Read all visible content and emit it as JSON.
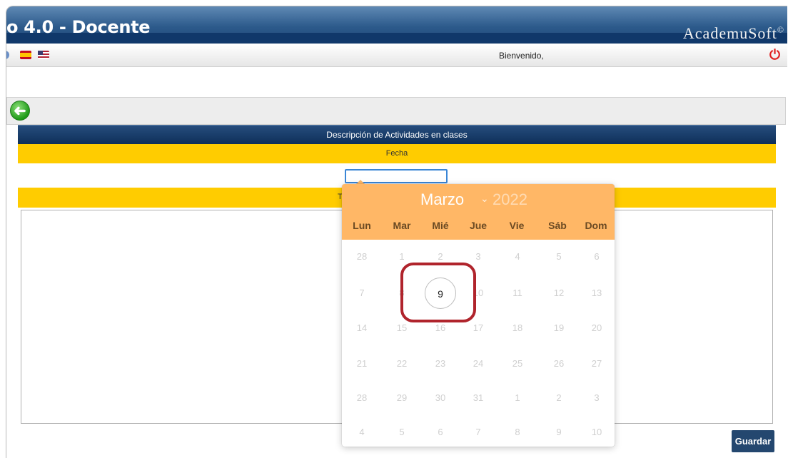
{
  "banner": {
    "title": "o 4.0 - Docente",
    "brand": "AcademuSoft",
    "brand_mark": "©"
  },
  "toolbar": {
    "welcome": "Bienvenido,",
    "icons": [
      "help-icon",
      "spanish-flag-icon",
      "english-flag-icon",
      "power-icon"
    ]
  },
  "navbar": {
    "back_icon": "arrow-left-icon",
    "back_glyph": "➜"
  },
  "form": {
    "header": "Descripción de Actividades en clases",
    "fecha_label": "Fecha",
    "date_value": "",
    "second_label": "T",
    "textarea_value": "",
    "save_label": "Guardar"
  },
  "datepicker": {
    "month": "Marzo",
    "year": "2022",
    "weekdays": [
      "Lun",
      "Mar",
      "Mié",
      "Jue",
      "Vie",
      "Sáb",
      "Dom"
    ],
    "weeks": [
      [
        "28",
        "1",
        "2",
        "3",
        "4",
        "5",
        "6"
      ],
      [
        "7",
        "8",
        "9",
        "10",
        "11",
        "12",
        "13"
      ],
      [
        "14",
        "15",
        "16",
        "17",
        "18",
        "19",
        "20"
      ],
      [
        "21",
        "22",
        "23",
        "24",
        "25",
        "26",
        "27"
      ],
      [
        "28",
        "29",
        "30",
        "31",
        "1",
        "2",
        "3"
      ],
      [
        "4",
        "5",
        "6",
        "7",
        "8",
        "9",
        "10"
      ]
    ],
    "selected_day": "9",
    "header_color": "#ffb766",
    "annotation_color": "#b0242c"
  }
}
